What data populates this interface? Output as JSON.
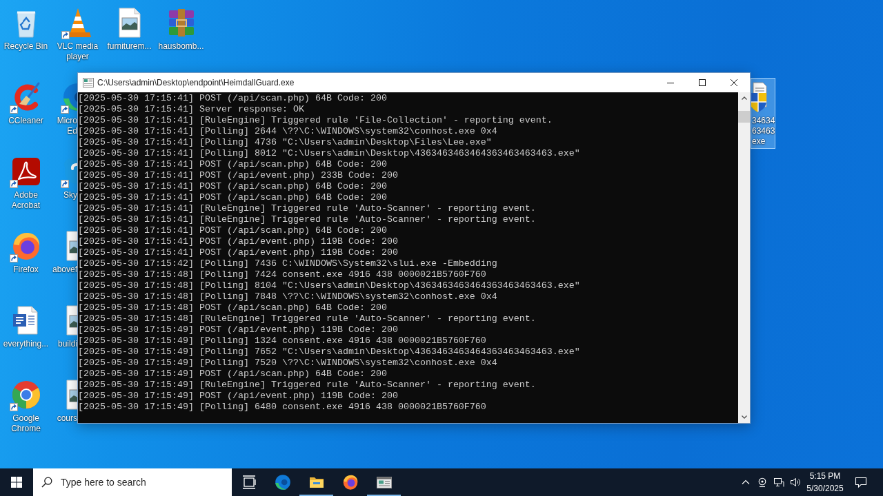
{
  "desktop": {
    "columns": [
      {
        "icons": [
          {
            "kind": "recycle-bin",
            "label": "Recycle Bin",
            "shortcut": false,
            "selected": false,
            "partly_hidden": false
          },
          {
            "kind": "ccleaner",
            "label": "CCleaner",
            "shortcut": true,
            "selected": false,
            "partly_hidden": false
          },
          {
            "kind": "acrobat",
            "label": "Adobe Acrobat",
            "shortcut": true,
            "selected": false,
            "partly_hidden": false
          },
          {
            "kind": "firefox",
            "label": "Firefox",
            "shortcut": true,
            "selected": false,
            "partly_hidden": false
          },
          {
            "kind": "word-document",
            "label": "everything...",
            "shortcut": false,
            "selected": false,
            "partly_hidden": false
          },
          {
            "kind": "chrome",
            "label": "Google Chrome",
            "shortcut": true,
            "selected": false,
            "partly_hidden": false
          }
        ]
      },
      {
        "icons": [
          {
            "kind": "vlc",
            "label": "VLC media player",
            "shortcut": true,
            "selected": false,
            "partly_hidden": false
          },
          {
            "kind": "edge",
            "label": "Micro\nEd",
            "shortcut": true,
            "selected": false,
            "partly_hidden": true
          },
          {
            "kind": "skype",
            "label": "Sky",
            "shortcut": true,
            "selected": false,
            "partly_hidden": true
          },
          {
            "kind": "image-file",
            "label": "abovef",
            "shortcut": false,
            "selected": false,
            "partly_hidden": true
          },
          {
            "kind": "image-file",
            "label": "buildi",
            "shortcut": false,
            "selected": false,
            "partly_hidden": true
          },
          {
            "kind": "image-file",
            "label": "cours",
            "shortcut": false,
            "selected": false,
            "partly_hidden": true
          }
        ]
      },
      {
        "icons": [
          {
            "kind": "image-file",
            "label": "furniturem...",
            "shortcut": false,
            "selected": false,
            "partly_hidden": false
          }
        ]
      },
      {
        "icons": [
          {
            "kind": "archive",
            "label": "hausbomb...",
            "shortcut": false,
            "selected": false,
            "partly_hidden": false
          }
        ]
      }
    ],
    "right_columns": [
      {
        "icons": [
          {
            "kind": "shield-document",
            "label": "34634\n63463\nexe",
            "shortcut": false,
            "selected": true,
            "partly_hidden": true
          }
        ]
      }
    ]
  },
  "window": {
    "title": "C:\\Users\\admin\\Desktop\\endpoint\\HeimdallGuard.exe",
    "lines": [
      "[2025-05-30 17:15:41] POST (/api/scan.php) 64B Code: 200",
      "[2025-05-30 17:15:41] Server response: OK",
      "[2025-05-30 17:15:41] [RuleEngine] Triggered rule 'File-Collection' - reporting event.",
      "[2025-05-30 17:15:41] [Polling] 2644 \\??\\C:\\WINDOWS\\system32\\conhost.exe 0x4",
      "[2025-05-30 17:15:41] [Polling] 4736 \"C:\\Users\\admin\\Desktop\\Files\\Lee.exe\"",
      "[2025-05-30 17:15:41] [Polling] 8012 \"C:\\Users\\admin\\Desktop\\4363463463464363463463463.exe\"",
      "[2025-05-30 17:15:41] POST (/api/scan.php) 64B Code: 200",
      "[2025-05-30 17:15:41] POST (/api/event.php) 233B Code: 200",
      "[2025-05-30 17:15:41] POST (/api/scan.php) 64B Code: 200",
      "[2025-05-30 17:15:41] POST (/api/scan.php) 64B Code: 200",
      "[2025-05-30 17:15:41] [RuleEngine] Triggered rule 'Auto-Scanner' - reporting event.",
      "[2025-05-30 17:15:41] [RuleEngine] Triggered rule 'Auto-Scanner' - reporting event.",
      "[2025-05-30 17:15:41] POST (/api/scan.php) 64B Code: 200",
      "[2025-05-30 17:15:41] POST (/api/event.php) 119B Code: 200",
      "[2025-05-30 17:15:41] POST (/api/event.php) 119B Code: 200",
      "[2025-05-30 17:15:42] [Polling] 7436 C:\\WINDOWS\\System32\\slui.exe -Embedding",
      "[2025-05-30 17:15:48] [Polling] 7424 consent.exe 4916 438 0000021B5760F760",
      "[2025-05-30 17:15:48] [Polling] 8104 \"C:\\Users\\admin\\Desktop\\4363463463464363463463463.exe\"",
      "[2025-05-30 17:15:48] [Polling] 7848 \\??\\C:\\WINDOWS\\system32\\conhost.exe 0x4",
      "[2025-05-30 17:15:48] POST (/api/scan.php) 64B Code: 200",
      "[2025-05-30 17:15:48] [RuleEngine] Triggered rule 'Auto-Scanner' - reporting event.",
      "[2025-05-30 17:15:49] POST (/api/event.php) 119B Code: 200",
      "[2025-05-30 17:15:49] [Polling] 1324 consent.exe 4916 438 0000021B5760F760",
      "[2025-05-30 17:15:49] [Polling] 7652 \"C:\\Users\\admin\\Desktop\\4363463463464363463463463.exe\"",
      "[2025-05-30 17:15:49] [Polling] 7520 \\??\\C:\\WINDOWS\\system32\\conhost.exe 0x4",
      "[2025-05-30 17:15:49] POST (/api/scan.php) 64B Code: 200",
      "[2025-05-30 17:15:49] [RuleEngine] Triggered rule 'Auto-Scanner' - reporting event.",
      "[2025-05-30 17:15:49] POST (/api/event.php) 119B Code: 200",
      "[2025-05-30 17:15:49] [Polling] 6480 consent.exe 4916 438 0000021B5760F760"
    ]
  },
  "taskbar": {
    "search": {
      "placeholder": "Type here to search"
    },
    "apps": [
      {
        "kind": "task-view",
        "running": false
      },
      {
        "kind": "edge",
        "running": false
      },
      {
        "kind": "file-explorer",
        "running": true
      },
      {
        "kind": "firefox",
        "running": false
      },
      {
        "kind": "console",
        "running": true
      }
    ],
    "clock": {
      "time": "5:15 PM",
      "date": "5/30/2025"
    }
  }
}
